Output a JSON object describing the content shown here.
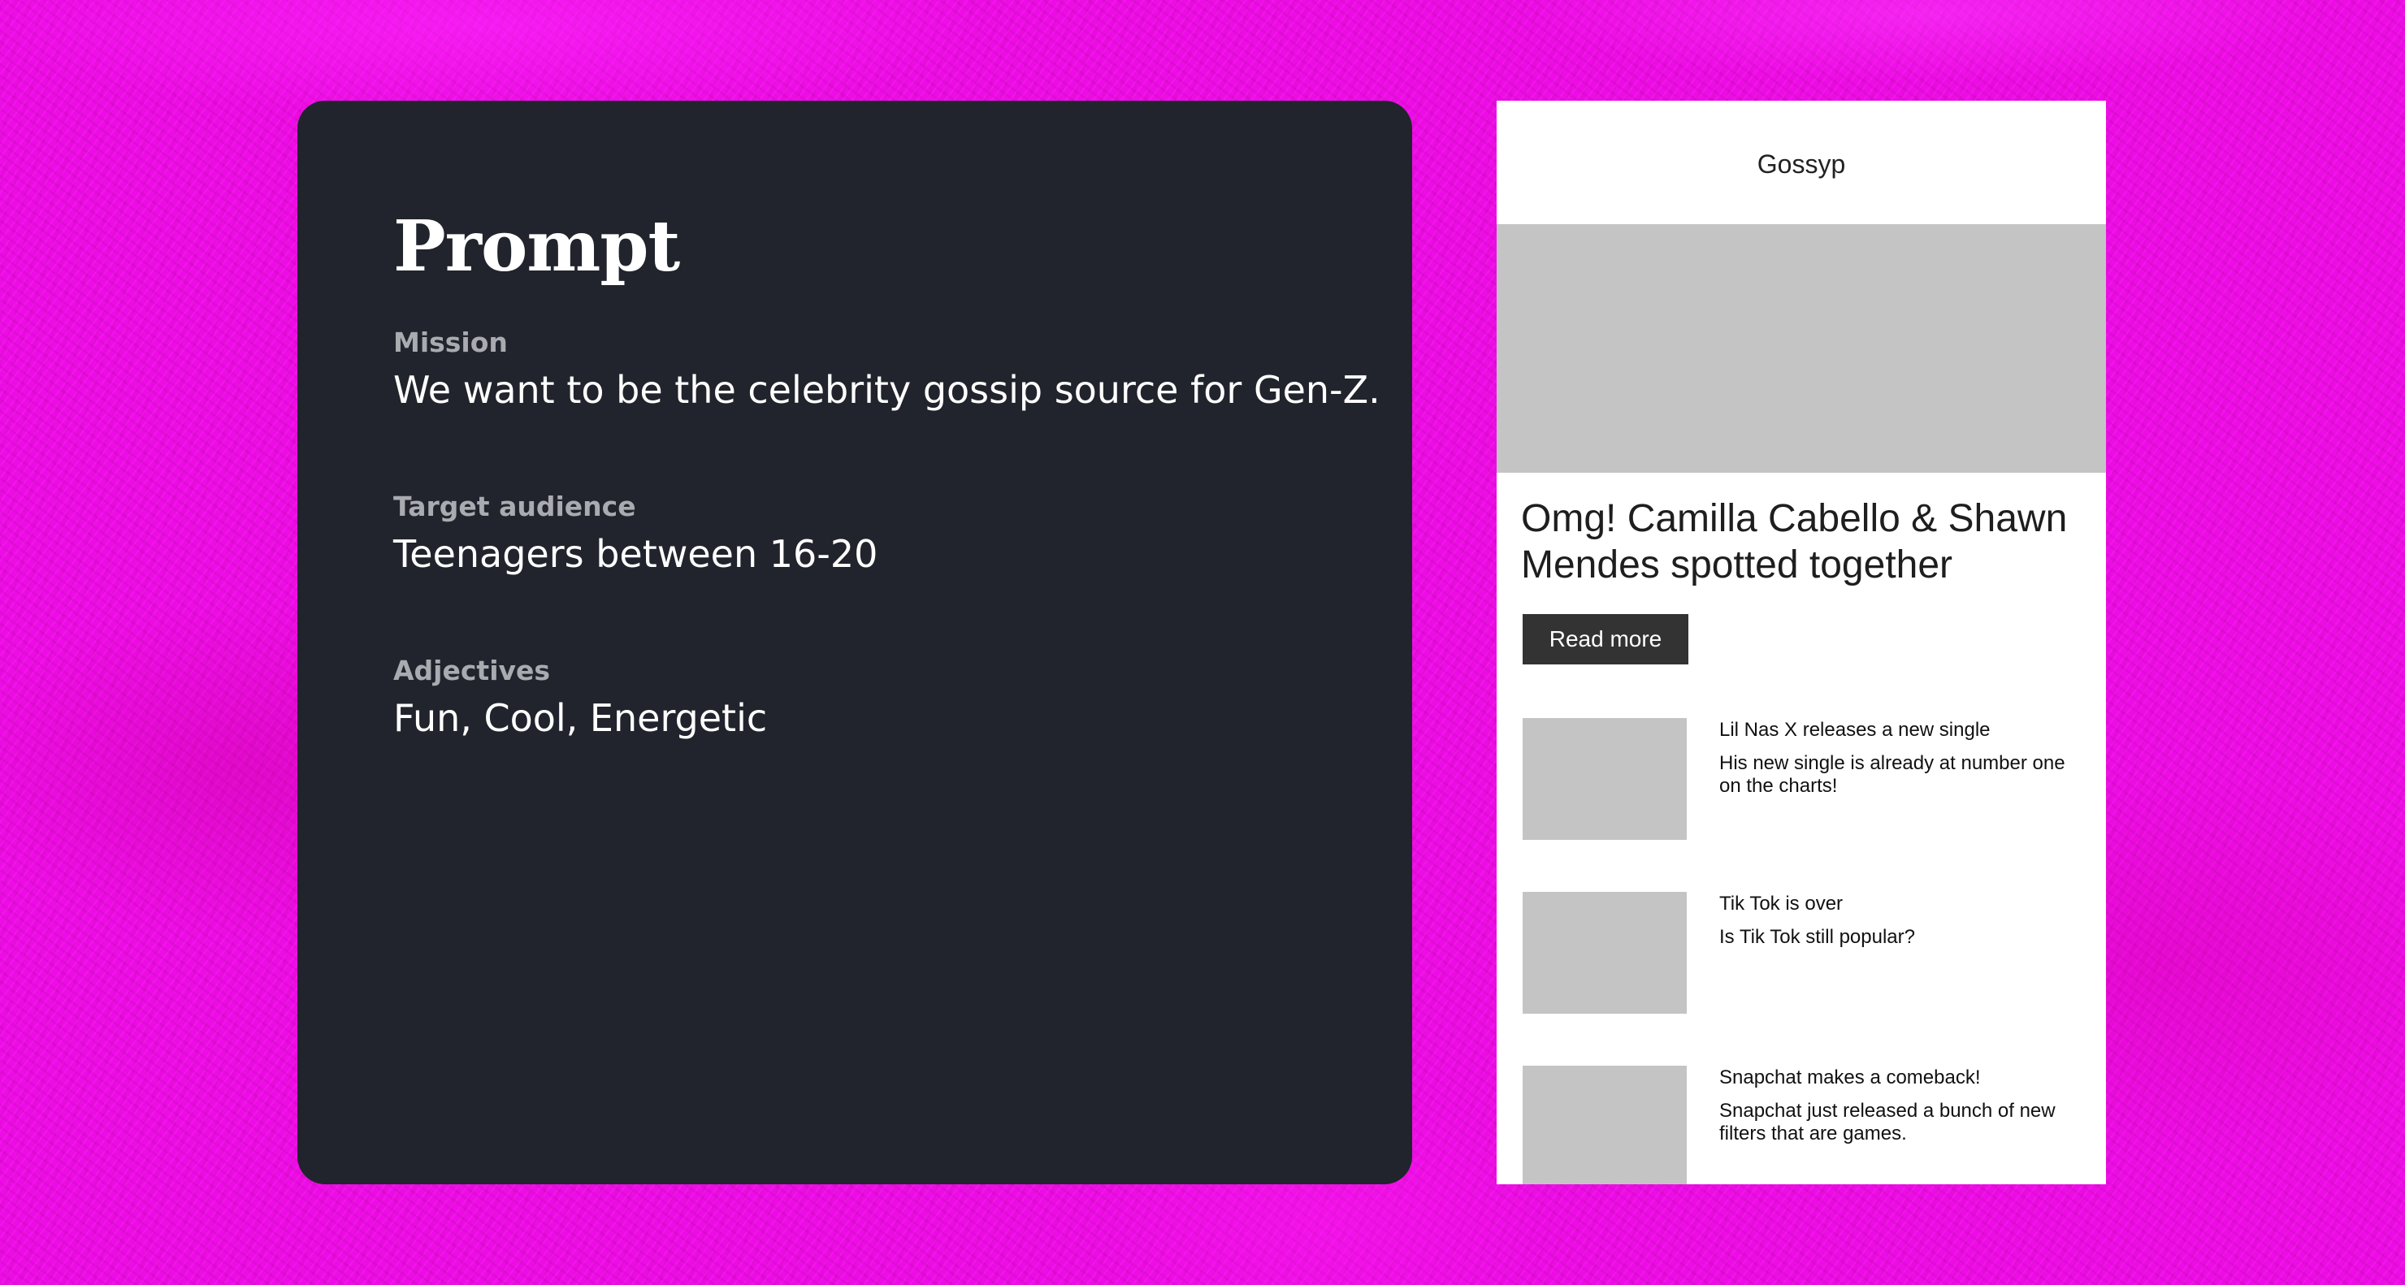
{
  "prompt": {
    "title": "Prompt",
    "sections": [
      {
        "label": "Mission",
        "value": "We want to be the celebrity gossip source for Gen-Z."
      },
      {
        "label": "Target audience",
        "value": "Teenagers between 16-20"
      },
      {
        "label": "Adjectives",
        "value": "Fun, Cool, Energetic"
      }
    ]
  },
  "mockup": {
    "brand": "Gossyp",
    "hero": {
      "title": "Omg! Camilla Cabello & Shawn Mendes spotted together",
      "button_label": "Read more"
    },
    "articles": [
      {
        "title": "Lil Nas X releases a new single",
        "description": "His new single is already at number one on the charts!"
      },
      {
        "title": "Tik Tok is over",
        "description": "Is Tik Tok still popular?"
      },
      {
        "title": "Snapchat makes a comeback!",
        "description": "Snapchat just released a bunch of new filters that are games."
      }
    ]
  },
  "colors": {
    "background": "#ee0ce6",
    "prompt_card": "#21242c",
    "label_gray": "#a9abb0",
    "placeholder_gray": "#c4c4c4",
    "button_dark": "#333333"
  }
}
